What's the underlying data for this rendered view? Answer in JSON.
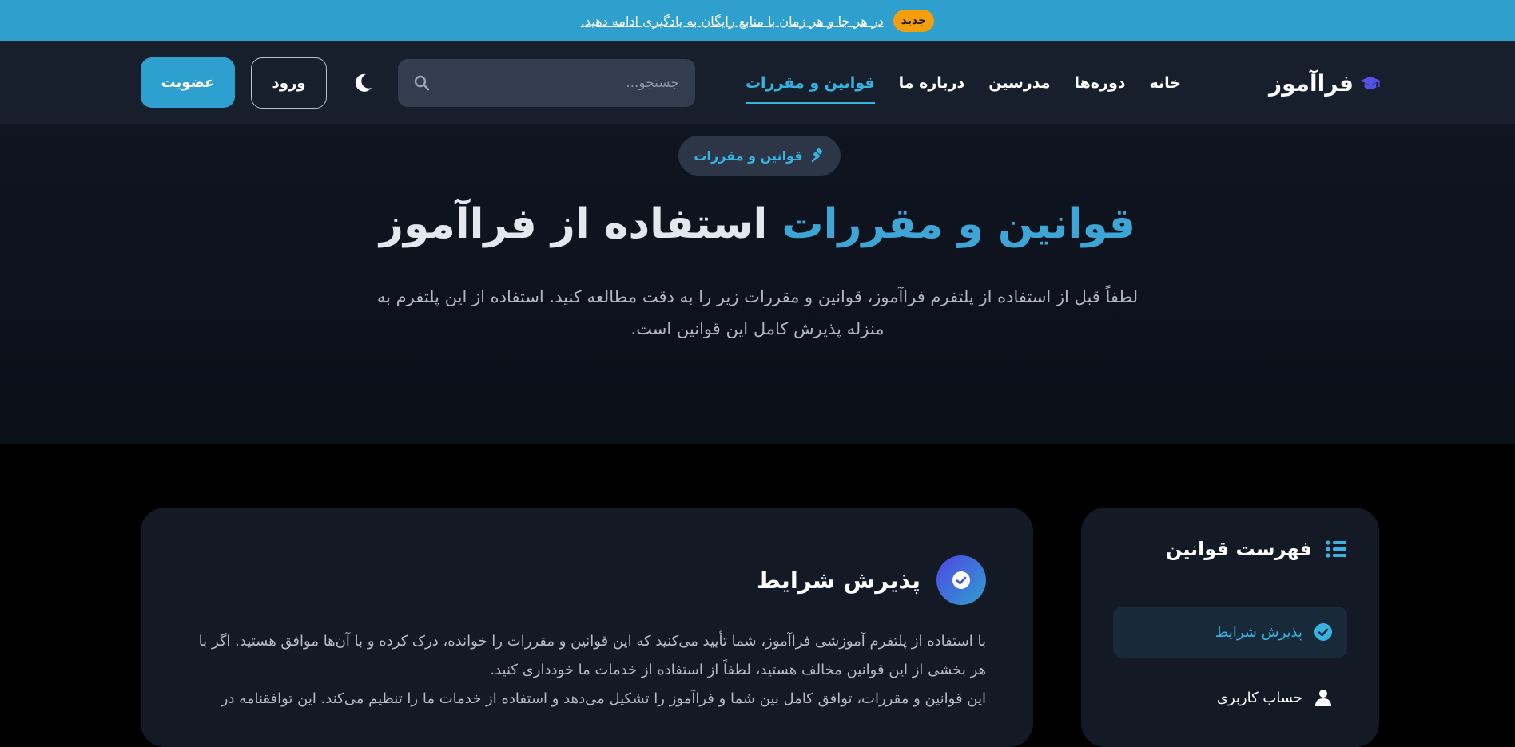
{
  "announcement": {
    "text": "در هر جا و هر زمان با منابع رایگان به یادگیری ادامه دهید.",
    "badge": "جدید"
  },
  "header": {
    "logo_text": "فراآموز",
    "nav": [
      {
        "label": "خانه",
        "active": false
      },
      {
        "label": "دوره‌ها",
        "active": false
      },
      {
        "label": "مدرسین",
        "active": false
      },
      {
        "label": "درباره ما",
        "active": false
      },
      {
        "label": "قوانین و مقررات",
        "active": true
      }
    ],
    "search": {
      "placeholder": "جستجو..."
    },
    "login_label": "ورود",
    "join_label": "عضویت"
  },
  "hero": {
    "chip_label": "قوانین و مقررات",
    "title_highlight": "قوانین و مقررات",
    "title_rest": "استفاده از فراآموز",
    "description": "لطفاً قبل از استفاده از پلتفرم فراآموز، قوانین و مقررات زیر را به دقت مطالعه کنید. استفاده از این پلتفرم به منزله پذیرش کامل این قوانین است."
  },
  "content": {
    "section_title": "پذیرش شرایط",
    "paragraph_1": "با استفاده از پلتفرم آموزشی فراآموز، شما تأیید می‌کنید که این قوانین و مقررات را خوانده، درک کرده و با آن‌ها موافق هستید. اگر با هر بخشی از این قوانین مخالف هستید، لطفاً از استفاده از خدمات ما خودداری کنید.",
    "paragraph_2": "این قوانین و مقررات، توافق کامل بین شما و فراآموز را تشکیل می‌دهد و استفاده از خدمات ما را تنظیم می‌کند. این توافقنامه در"
  },
  "toc": {
    "title": "فهرست قوانین",
    "items": [
      {
        "label": "پذیرش شرایط",
        "icon": "check-circle-icon",
        "active": true
      },
      {
        "label": "حساب کاربری",
        "icon": "user-icon",
        "active": false
      }
    ]
  },
  "colors": {
    "accent": "#2f9fce",
    "badge": "#f59e0b",
    "header_bg": "#171e2c",
    "card_bg": "#131a26"
  }
}
